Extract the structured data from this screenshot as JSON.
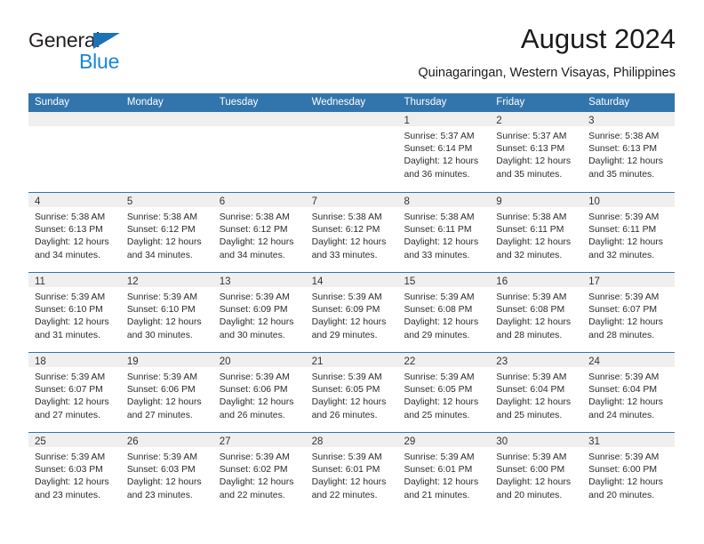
{
  "brand": {
    "name_part1": "General",
    "name_part2": "Blue",
    "accent_color": "#1a86d6",
    "triangle_color": "#1a72b8"
  },
  "header": {
    "title": "August 2024",
    "location": "Quinagaringan, Western Visayas, Philippines"
  },
  "calendar": {
    "header_color": "#3275ac",
    "band_color": "#efefef",
    "weekdays": [
      "Sunday",
      "Monday",
      "Tuesday",
      "Wednesday",
      "Thursday",
      "Friday",
      "Saturday"
    ],
    "weeks": [
      [
        {
          "day": "",
          "lines": []
        },
        {
          "day": "",
          "lines": []
        },
        {
          "day": "",
          "lines": []
        },
        {
          "day": "",
          "lines": []
        },
        {
          "day": "1",
          "lines": [
            "Sunrise: 5:37 AM",
            "Sunset: 6:14 PM",
            "Daylight: 12 hours",
            "and 36 minutes."
          ]
        },
        {
          "day": "2",
          "lines": [
            "Sunrise: 5:37 AM",
            "Sunset: 6:13 PM",
            "Daylight: 12 hours",
            "and 35 minutes."
          ]
        },
        {
          "day": "3",
          "lines": [
            "Sunrise: 5:38 AM",
            "Sunset: 6:13 PM",
            "Daylight: 12 hours",
            "and 35 minutes."
          ]
        }
      ],
      [
        {
          "day": "4",
          "lines": [
            "Sunrise: 5:38 AM",
            "Sunset: 6:13 PM",
            "Daylight: 12 hours",
            "and 34 minutes."
          ]
        },
        {
          "day": "5",
          "lines": [
            "Sunrise: 5:38 AM",
            "Sunset: 6:12 PM",
            "Daylight: 12 hours",
            "and 34 minutes."
          ]
        },
        {
          "day": "6",
          "lines": [
            "Sunrise: 5:38 AM",
            "Sunset: 6:12 PM",
            "Daylight: 12 hours",
            "and 34 minutes."
          ]
        },
        {
          "day": "7",
          "lines": [
            "Sunrise: 5:38 AM",
            "Sunset: 6:12 PM",
            "Daylight: 12 hours",
            "and 33 minutes."
          ]
        },
        {
          "day": "8",
          "lines": [
            "Sunrise: 5:38 AM",
            "Sunset: 6:11 PM",
            "Daylight: 12 hours",
            "and 33 minutes."
          ]
        },
        {
          "day": "9",
          "lines": [
            "Sunrise: 5:38 AM",
            "Sunset: 6:11 PM",
            "Daylight: 12 hours",
            "and 32 minutes."
          ]
        },
        {
          "day": "10",
          "lines": [
            "Sunrise: 5:39 AM",
            "Sunset: 6:11 PM",
            "Daylight: 12 hours",
            "and 32 minutes."
          ]
        }
      ],
      [
        {
          "day": "11",
          "lines": [
            "Sunrise: 5:39 AM",
            "Sunset: 6:10 PM",
            "Daylight: 12 hours",
            "and 31 minutes."
          ]
        },
        {
          "day": "12",
          "lines": [
            "Sunrise: 5:39 AM",
            "Sunset: 6:10 PM",
            "Daylight: 12 hours",
            "and 30 minutes."
          ]
        },
        {
          "day": "13",
          "lines": [
            "Sunrise: 5:39 AM",
            "Sunset: 6:09 PM",
            "Daylight: 12 hours",
            "and 30 minutes."
          ]
        },
        {
          "day": "14",
          "lines": [
            "Sunrise: 5:39 AM",
            "Sunset: 6:09 PM",
            "Daylight: 12 hours",
            "and 29 minutes."
          ]
        },
        {
          "day": "15",
          "lines": [
            "Sunrise: 5:39 AM",
            "Sunset: 6:08 PM",
            "Daylight: 12 hours",
            "and 29 minutes."
          ]
        },
        {
          "day": "16",
          "lines": [
            "Sunrise: 5:39 AM",
            "Sunset: 6:08 PM",
            "Daylight: 12 hours",
            "and 28 minutes."
          ]
        },
        {
          "day": "17",
          "lines": [
            "Sunrise: 5:39 AM",
            "Sunset: 6:07 PM",
            "Daylight: 12 hours",
            "and 28 minutes."
          ]
        }
      ],
      [
        {
          "day": "18",
          "lines": [
            "Sunrise: 5:39 AM",
            "Sunset: 6:07 PM",
            "Daylight: 12 hours",
            "and 27 minutes."
          ]
        },
        {
          "day": "19",
          "lines": [
            "Sunrise: 5:39 AM",
            "Sunset: 6:06 PM",
            "Daylight: 12 hours",
            "and 27 minutes."
          ]
        },
        {
          "day": "20",
          "lines": [
            "Sunrise: 5:39 AM",
            "Sunset: 6:06 PM",
            "Daylight: 12 hours",
            "and 26 minutes."
          ]
        },
        {
          "day": "21",
          "lines": [
            "Sunrise: 5:39 AM",
            "Sunset: 6:05 PM",
            "Daylight: 12 hours",
            "and 26 minutes."
          ]
        },
        {
          "day": "22",
          "lines": [
            "Sunrise: 5:39 AM",
            "Sunset: 6:05 PM",
            "Daylight: 12 hours",
            "and 25 minutes."
          ]
        },
        {
          "day": "23",
          "lines": [
            "Sunrise: 5:39 AM",
            "Sunset: 6:04 PM",
            "Daylight: 12 hours",
            "and 25 minutes."
          ]
        },
        {
          "day": "24",
          "lines": [
            "Sunrise: 5:39 AM",
            "Sunset: 6:04 PM",
            "Daylight: 12 hours",
            "and 24 minutes."
          ]
        }
      ],
      [
        {
          "day": "25",
          "lines": [
            "Sunrise: 5:39 AM",
            "Sunset: 6:03 PM",
            "Daylight: 12 hours",
            "and 23 minutes."
          ]
        },
        {
          "day": "26",
          "lines": [
            "Sunrise: 5:39 AM",
            "Sunset: 6:03 PM",
            "Daylight: 12 hours",
            "and 23 minutes."
          ]
        },
        {
          "day": "27",
          "lines": [
            "Sunrise: 5:39 AM",
            "Sunset: 6:02 PM",
            "Daylight: 12 hours",
            "and 22 minutes."
          ]
        },
        {
          "day": "28",
          "lines": [
            "Sunrise: 5:39 AM",
            "Sunset: 6:01 PM",
            "Daylight: 12 hours",
            "and 22 minutes."
          ]
        },
        {
          "day": "29",
          "lines": [
            "Sunrise: 5:39 AM",
            "Sunset: 6:01 PM",
            "Daylight: 12 hours",
            "and 21 minutes."
          ]
        },
        {
          "day": "30",
          "lines": [
            "Sunrise: 5:39 AM",
            "Sunset: 6:00 PM",
            "Daylight: 12 hours",
            "and 20 minutes."
          ]
        },
        {
          "day": "31",
          "lines": [
            "Sunrise: 5:39 AM",
            "Sunset: 6:00 PM",
            "Daylight: 12 hours",
            "and 20 minutes."
          ]
        }
      ]
    ]
  }
}
